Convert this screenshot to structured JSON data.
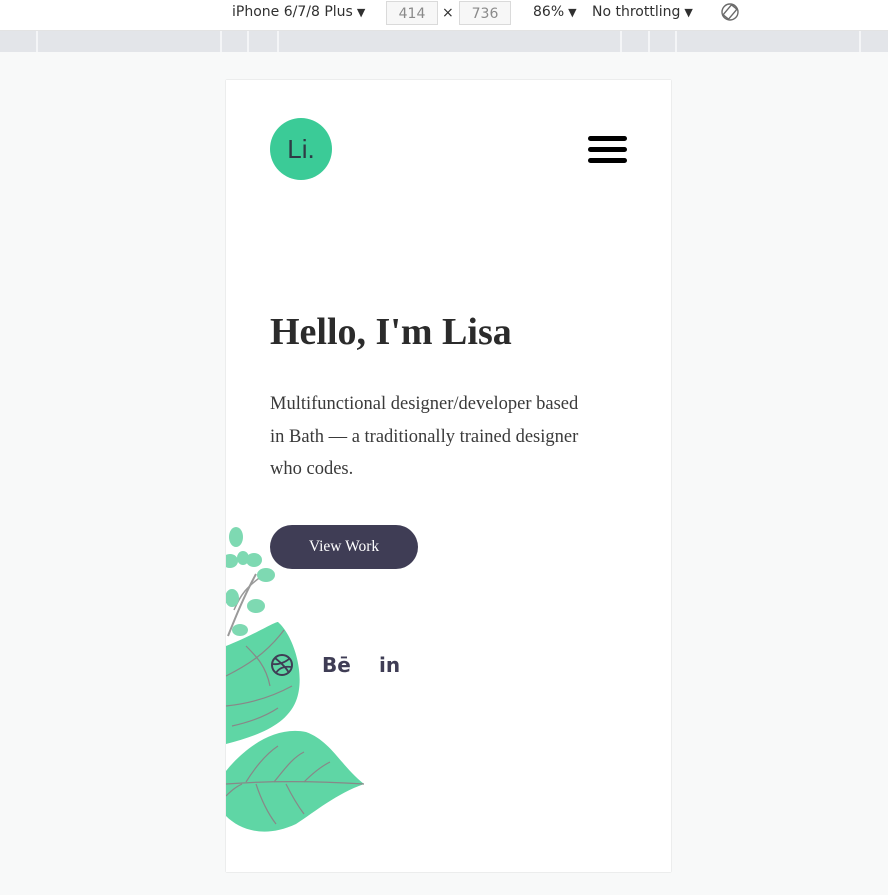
{
  "devtools": {
    "device": "iPhone 6/7/8 Plus",
    "width": "414",
    "height": "736",
    "times": "×",
    "zoom": "86%",
    "throttling": "No throttling",
    "dropdown_arrow": "▼"
  },
  "site": {
    "logo_text": "Li.",
    "menu_icon": "hamburger-icon",
    "hero": {
      "title": "Hello, I'm Lisa",
      "description": "Multifunctional designer/developer based in Bath — a traditionally trained designer who codes.",
      "cta_label": "View Work"
    },
    "social": {
      "dribbble_icon": "dribbble-icon",
      "behance_label": "Bē",
      "linkedin_label": "in"
    }
  },
  "colors": {
    "accent": "#3bcb97",
    "button": "#3f3d55",
    "leaf": "#5fd6a5",
    "text": "#2b2b2b"
  }
}
